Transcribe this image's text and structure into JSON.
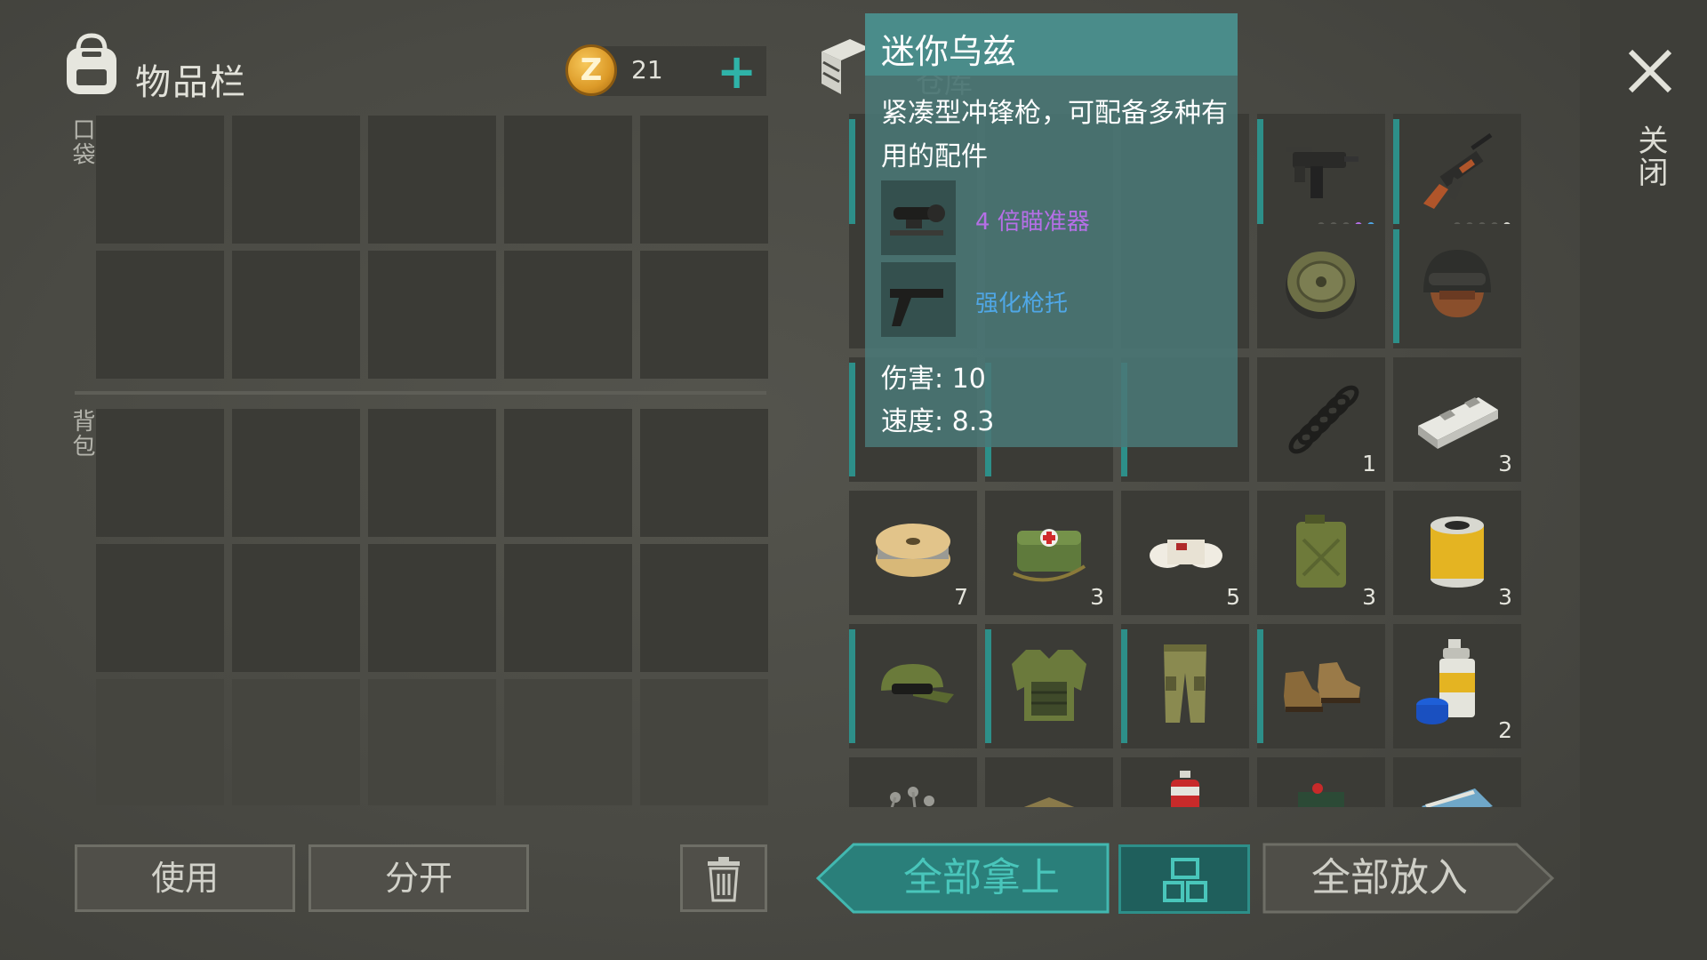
{
  "inventory": {
    "title": "物品栏",
    "currency_icon": "coin-icon",
    "coin_glyph": "Z",
    "coin_count": "21",
    "add_coins_glyph": "+",
    "pockets_label": "口袋",
    "backpack_label": "背包"
  },
  "storage": {
    "icon": "storage-crate-icon",
    "title_partial": "仓库"
  },
  "tooltip": {
    "item_name": "迷你乌兹",
    "description": "紧凑型冲锋枪，可配备多种有用的配件",
    "attachments": [
      {
        "name": "4 倍瞄准器",
        "color": "#b56fe6",
        "icon": "scope-icon"
      },
      {
        "name": "强化枪托",
        "color": "#4fa7e6",
        "icon": "stock-icon"
      }
    ],
    "damage": "伤害: 10",
    "speed": "速度: 8.3"
  },
  "storage_items": [
    {
      "name": "mini-uzi-icon",
      "count": ""
    },
    {
      "name": "ak47-icon",
      "count": ""
    },
    {
      "name": "landmine-icon",
      "count": ""
    },
    {
      "name": "military-helmet-icon",
      "count": ""
    },
    {
      "name": "spring-icon",
      "count": "1"
    },
    {
      "name": "metal-bar-icon",
      "count": "3"
    },
    {
      "name": "wire-spool-icon",
      "count": "7"
    },
    {
      "name": "medical-bag-icon",
      "count": "3"
    },
    {
      "name": "bandage-icon",
      "count": "5"
    },
    {
      "name": "jerrycan-icon",
      "count": "3"
    },
    {
      "name": "oil-filter-icon",
      "count": "3"
    },
    {
      "name": "camo-cap-icon",
      "count": ""
    },
    {
      "name": "camo-vest-icon",
      "count": ""
    },
    {
      "name": "camo-pants-icon",
      "count": ""
    },
    {
      "name": "boots-icon",
      "count": ""
    },
    {
      "name": "spray-paint-icon",
      "count": "2"
    }
  ],
  "buttons": {
    "use": "使用",
    "split": "分开",
    "take_all": "全部拿上",
    "put_all": "全部放入",
    "close": "关闭"
  },
  "colors": {
    "accent_teal": "#2d8f89",
    "tooltip_bg": "#4a8c8a"
  }
}
